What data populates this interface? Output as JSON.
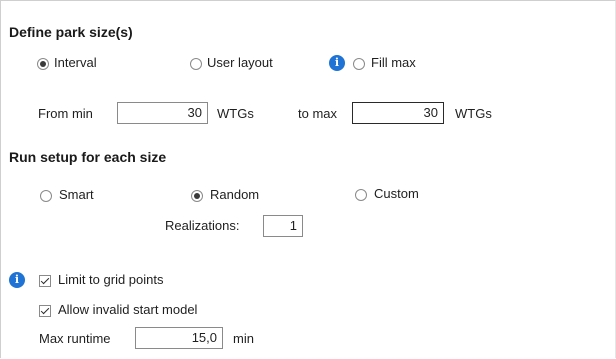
{
  "sections": {
    "park_size": {
      "title": "Define park size(s)"
    },
    "run_setup": {
      "title": "Run setup for each size"
    }
  },
  "park_size_options": {
    "interval": "Interval",
    "user_layout": "User layout",
    "fill_max": "Fill max",
    "selected": "Interval"
  },
  "range": {
    "from_label": "From min",
    "from_value": "30",
    "from_unit": "WTGs",
    "to_label": "to max",
    "to_value": "30",
    "to_unit": "WTGs"
  },
  "run_options": {
    "smart": "Smart",
    "random": "Random",
    "custom": "Custom",
    "selected": "Random",
    "realizations_label": "Realizations:",
    "realizations_value": "1"
  },
  "constraints": {
    "limit_grid_label": "Limit to grid points",
    "limit_grid_checked": true,
    "allow_invalid_label": "Allow invalid start model",
    "allow_invalid_checked": true,
    "max_runtime_label": "Max runtime",
    "max_runtime_value": "15,0",
    "max_runtime_unit": "min"
  },
  "icons": {
    "info": "i",
    "info_color": "#1e73d4"
  }
}
